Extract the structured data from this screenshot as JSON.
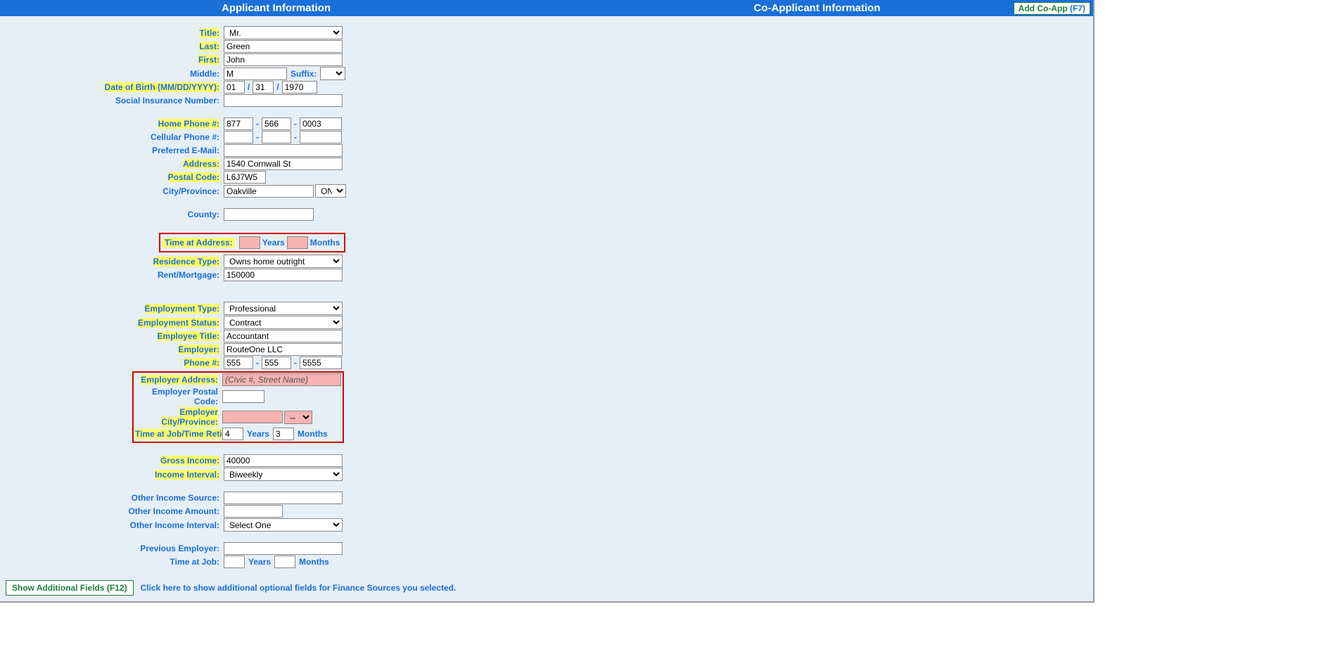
{
  "header": {
    "applicant": "Applicant Information",
    "coapplicant": "Co-Applicant Information",
    "add_coapp": "Add Co-App",
    "add_coapp_shortcut": "(F7)"
  },
  "labels": {
    "title": "Title:",
    "last": "Last:",
    "first": "First:",
    "middle": "Middle:",
    "suffix": "Suffix:",
    "dob": "Date of Birth (MM/DD/YYYY):",
    "sin": "Social Insurance Number:",
    "home_phone": "Home Phone #:",
    "cell_phone": "Cellular Phone #:",
    "email": "Preferred E-Mail:",
    "address": "Address:",
    "postal": "Postal Code:",
    "city_prov": "City/Province:",
    "county": "County:",
    "time_addr": "Time at Address:",
    "residence_type": "Residence Type:",
    "rent_mortgage": "Rent/Mortgage:",
    "emp_type": "Employment Type:",
    "emp_status": "Employment Status:",
    "emp_title": "Employee Title:",
    "employer": "Employer:",
    "phone": "Phone #:",
    "emp_addr": "Employer Address:",
    "emp_postal": "Employer Postal Code:",
    "emp_city_prov": "Employer City/Province:",
    "time_job": "Time at Job/Time Retired:",
    "gross_income": "Gross Income:",
    "income_interval": "Income Interval:",
    "other_source": "Other Income Source:",
    "other_amount": "Other Income Amount:",
    "other_interval": "Other Income Interval:",
    "prev_employer": "Previous Employer:",
    "prev_time": "Time at Job:",
    "years": "Years",
    "months": "Months",
    "slash": "/",
    "dash": "-"
  },
  "values": {
    "title": "Mr.",
    "last": "Green",
    "first": "John",
    "middle": "M",
    "suffix": "",
    "dob_mm": "01",
    "dob_dd": "31",
    "dob_yyyy": "1970",
    "sin": "",
    "hp1": "877",
    "hp2": "566",
    "hp3": "0003",
    "cp1": "",
    "cp2": "",
    "cp3": "",
    "email": "",
    "address": "1540 Cornwall St",
    "postal": "L6J7W5",
    "city": "Oakville",
    "province": "ON",
    "county": "",
    "addr_years": "",
    "addr_months": "",
    "residence_type": "Owns home outright",
    "rent_mortgage": "150000",
    "emp_type": "Professional",
    "emp_status": "Contract",
    "emp_title": "Accountant",
    "employer": "RouteOne LLC",
    "ep1": "555",
    "ep2": "555",
    "ep3": "5555",
    "emp_addr_placeholder": "(Civic #, Street Name)",
    "emp_postal": "",
    "emp_city": "",
    "emp_prov": "--",
    "job_years": "4",
    "job_months": "3",
    "gross_income": "40000",
    "income_interval": "Biweekly",
    "other_source": "",
    "other_amount": "",
    "other_interval": "Select One",
    "prev_employer": "",
    "prev_years": "",
    "prev_months": ""
  },
  "footer": {
    "show_btn": "Show Additional Fields (F12)",
    "text": "Click here to show additional optional fields for Finance Sources you selected."
  }
}
